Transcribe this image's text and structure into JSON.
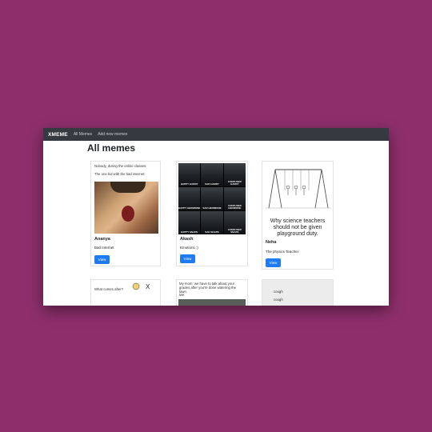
{
  "navbar": {
    "brand": "XMEME",
    "links": [
      "All Memes",
      "Add new memes"
    ]
  },
  "page_title": "All memes",
  "cards": [
    {
      "author": "Ananya",
      "caption": "Bad Internet",
      "button": "View",
      "image_text": [
        "Nobody, during the online classes:",
        "The one kid with the bad internet:"
      ]
    },
    {
      "author": "Akash",
      "caption": "Emotions :)",
      "button": "View",
      "image_labels": [
        "HAPPY HARRY",
        "SAD HARRY",
        "CONFUSED HARRY",
        "HAPPY HERMIONE",
        "SAD HERMIONE",
        "CONFUSED HERMIONE",
        "HAPPY SNAPE",
        "SAD SNAPE",
        "CONFUSED SNAPE"
      ]
    },
    {
      "author": "Neha",
      "caption": "The physics Teacher",
      "button": "View",
      "image_text": "Why science teachers should not be given playground duty."
    }
  ],
  "row2": {
    "card_a_text": "What comes after?",
    "card_b_text": "My mom: we have to talk about your grades after you're done watering the lawn.",
    "card_b_me": "Me:",
    "card_c_lines": [
      "cough",
      "cough"
    ]
  }
}
